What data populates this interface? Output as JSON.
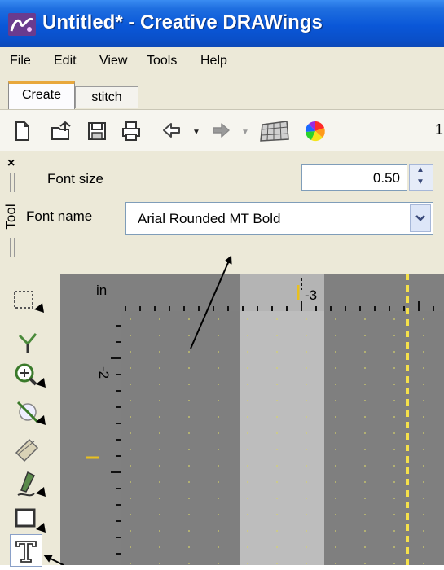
{
  "window": {
    "title": "Untitled* - Creative DRAWings"
  },
  "menu": {
    "items": [
      {
        "label": "File"
      },
      {
        "label": "Edit"
      },
      {
        "label": "View"
      },
      {
        "label": "Tools"
      },
      {
        "label": "Help"
      }
    ]
  },
  "tabs": [
    {
      "label": "Create",
      "active": true
    },
    {
      "label": "stitch",
      "active": false
    }
  ],
  "toolbar": {
    "icons": [
      "new-document-icon",
      "open-icon",
      "save-icon",
      "print-icon",
      "undo-icon",
      "redo-icon",
      "grid-icon",
      "color-wheel-icon"
    ],
    "trailing_text": "1"
  },
  "tool_panel": {
    "vertical_label": "Tool",
    "font_size": {
      "label": "Font size",
      "value": "0.50"
    },
    "font_name": {
      "label": "Font name",
      "value": "Arial Rounded MT Bold"
    }
  },
  "canvas": {
    "unit_label": "in",
    "ruler": {
      "top_label": "-3",
      "left_label": "-2"
    }
  },
  "colors": {
    "title_bar": "#0a57d8",
    "menu_bg": "#ece9d8",
    "canvas": "#808080",
    "guide": "#f5e14a",
    "tab_accent": "#e8a83c"
  }
}
